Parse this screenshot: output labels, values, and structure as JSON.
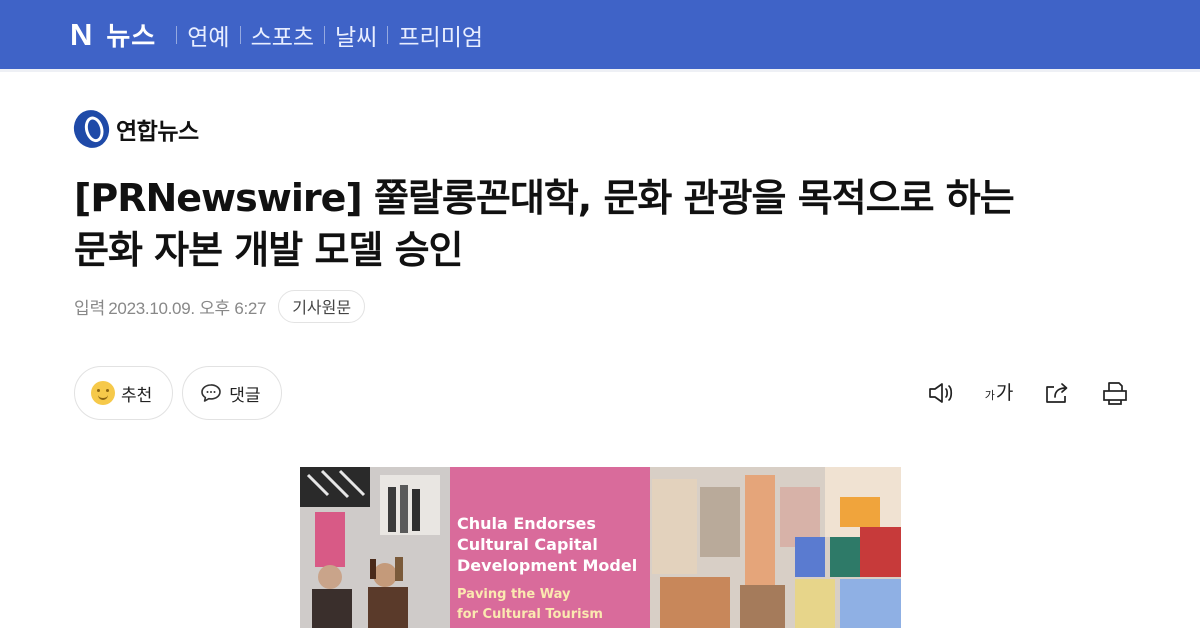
{
  "nav": {
    "logo": "N",
    "home": "뉴스",
    "links": [
      "연예",
      "스포츠",
      "날씨",
      "프리미엄"
    ]
  },
  "press": {
    "name": "연합뉴스"
  },
  "article": {
    "headline_line1": "[PRNewswire] 쭐랄롱꼰대학, 문화 관광을 목적으로 하는",
    "headline_line2": "문화 자본 개발 모델 승인",
    "date_label": "입력",
    "date": "2023.10.09. 오후 6:27",
    "original_button": "기사원문"
  },
  "reactions": {
    "recommend_label": "추천",
    "comment_label": "댓글"
  },
  "tools": {
    "font_small": "가",
    "font_large": "가"
  },
  "image": {
    "caption_lines": [
      "Chula Endorses",
      "Cultural Capital",
      "Development Model",
      "Paving the Way",
      "for Cultural Tourism"
    ]
  },
  "colors": {
    "topbar": "#3f63c7",
    "image_panel": "#d96b9b"
  }
}
